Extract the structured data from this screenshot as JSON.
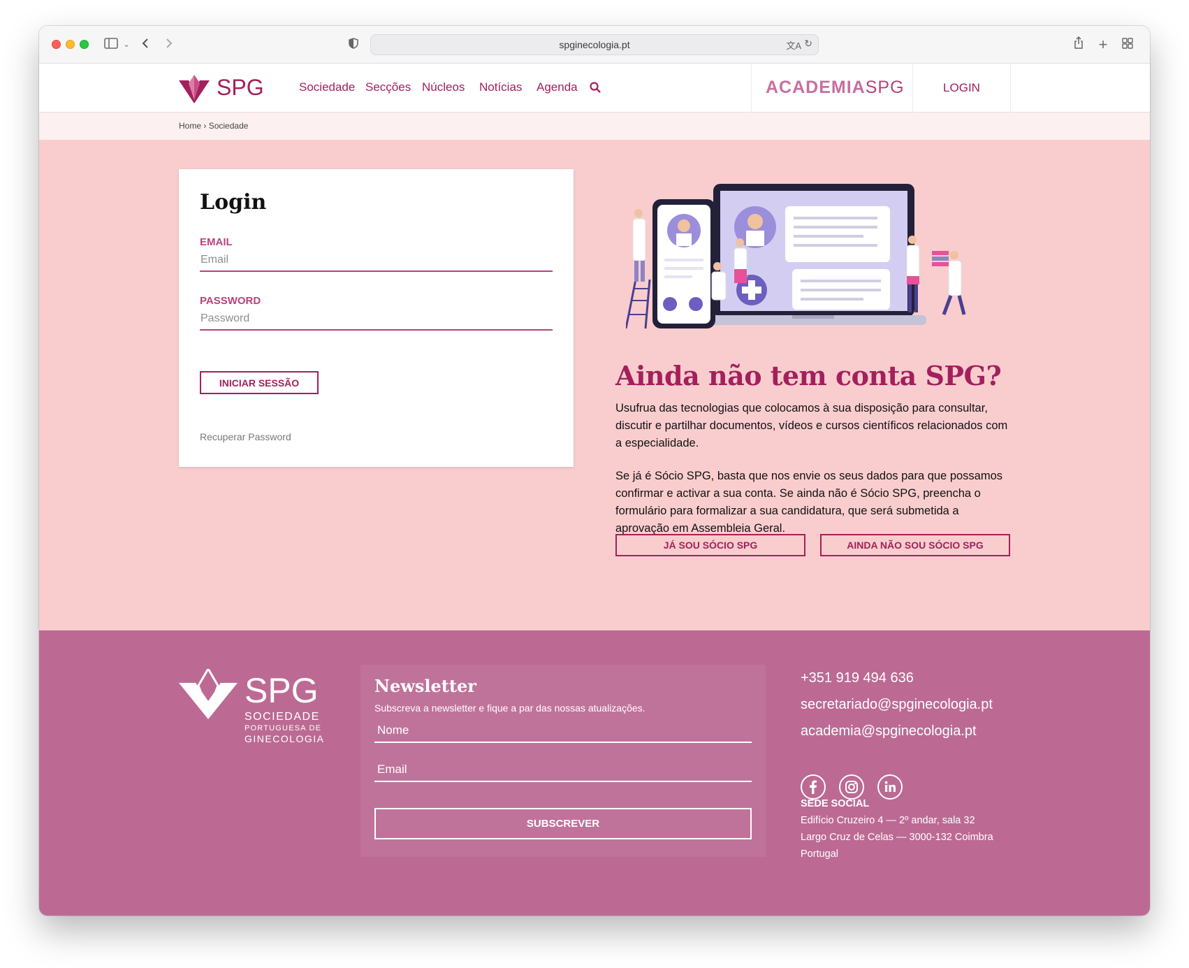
{
  "browser": {
    "url": "spginecologia.pt"
  },
  "header": {
    "logo_text": "SPG",
    "nav": [
      "Sociedade",
      "Secções",
      "Núcleos",
      "Notícias",
      "Agenda"
    ],
    "academia_label": "ACADEMIA",
    "academia_spg": "SPG",
    "login_label": "LOGIN"
  },
  "breadcrumb": {
    "home": "Home",
    "separator": "›",
    "current": "Sociedade"
  },
  "login": {
    "title": "Login",
    "email_label": "EMAIL",
    "email_placeholder": "Email",
    "password_label": "PASSWORD",
    "password_placeholder": "Password",
    "submit_label": "INICIAR SESSÃO",
    "recover_label": "Recuperar Password"
  },
  "cta": {
    "title": "Ainda não tem conta SPG?",
    "para1": "Usufrua das tecnologias que colocamos à sua disposição para consultar, discutir e partilhar documentos, vídeos e cursos científicos relacionados com a especialidade.",
    "para2": "Se já é Sócio SPG, basta que nos envie os seus dados para que possamos confirmar e activar a sua conta. Se ainda não é Sócio SPG, preencha o formulário para formalizar a sua candidatura, que será submetida a aprovação em Assembleia Geral.",
    "btn_member": "JÁ SOU SÓCIO SPG",
    "btn_not_member": "AINDA NÃO SOU SÓCIO SPG"
  },
  "footer": {
    "logo_spg": "SPG",
    "logo_line1": "SOCIEDADE",
    "logo_line2": "PORTUGUESA DE",
    "logo_line3": "GINECOLOGIA",
    "newsletter_title": "Newsletter",
    "newsletter_sub": "Subscreva a newsletter e fique a par das nossas atualizações.",
    "name_placeholder": "Nome",
    "email_placeholder": "Email",
    "subscribe_label": "SUBSCREVER",
    "phone": "+351 919 494 636",
    "email1": "secretariado@spginecologia.pt",
    "email2": "academia@spginecologia.pt",
    "social": [
      "facebook-icon",
      "instagram-icon",
      "linkedin-icon"
    ],
    "sede_title": "SEDE SOCIAL",
    "sede_line1": "Edifício Cruzeiro 4 — 2º andar, sala 32",
    "sede_line2": "Largo Cruz de Celas — 3000-132 Coimbra",
    "sede_line3": "Portugal"
  },
  "colors": {
    "brand": "#a3205c",
    "main_bg": "#f9cdce",
    "footer_bg": "#bc6a93"
  }
}
